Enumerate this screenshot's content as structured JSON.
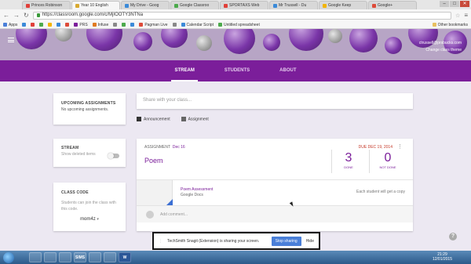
{
  "browser": {
    "tabs": [
      {
        "label": "Princes Robinson",
        "color": "#e0403a",
        "active": false
      },
      {
        "label": "Year 10 English",
        "color": "#d8a930",
        "active": true
      },
      {
        "label": "My Drive - Goog",
        "color": "#3b8ad8",
        "active": false
      },
      {
        "label": "Google Classroo",
        "color": "#4caa4c",
        "active": false
      },
      {
        "label": "SPORTAXS Web",
        "color": "#e0403a",
        "active": false
      },
      {
        "label": "Mr Trussell - Du",
        "color": "#3b8ad8",
        "active": false
      },
      {
        "label": "Google Keep",
        "color": "#f2b400",
        "active": false
      },
      {
        "label": "Google+",
        "color": "#dd4b39",
        "active": false
      }
    ],
    "window_controls": {
      "min": "–",
      "max": "□",
      "close": "✕"
    },
    "url": "https://classroom.google.com/c/MjIOOTY3NTNa",
    "bookmarks": [
      {
        "label": "Apps"
      },
      {
        "label": ""
      },
      {
        "label": ""
      },
      {
        "label": ""
      },
      {
        "label": ""
      },
      {
        "label": ""
      },
      {
        "label": ""
      },
      {
        "label": "PRS"
      },
      {
        "label": "Infuse"
      },
      {
        "label": ""
      },
      {
        "label": ""
      },
      {
        "label": ""
      },
      {
        "label": "Pagman Live"
      },
      {
        "label": ""
      },
      {
        "label": "Calendar Script"
      },
      {
        "label": "Untitled spreadsheet"
      },
      {
        "label": "Other bookmarks"
      }
    ]
  },
  "header": {
    "user_email": "ctrussell@prsbucks.com",
    "change_theme": "Change class theme"
  },
  "nav": {
    "tabs": [
      {
        "label": "STREAM",
        "active": true
      },
      {
        "label": "STUDENTS",
        "active": false
      },
      {
        "label": "ABOUT",
        "active": false
      }
    ]
  },
  "sidebar": {
    "upcoming_title": "UPCOMING ASSIGNMENTS",
    "upcoming_text": "No upcoming assignments.",
    "stream_title": "STREAM",
    "show_deleted": "Show deleted items",
    "class_code_title": "CLASS CODE",
    "class_code_text": "Students can join the class with this code.",
    "class_code_value": "mom4z"
  },
  "share": {
    "placeholder": "Share with your class...",
    "announcement": "Announcement",
    "assignment": "Assignment"
  },
  "assignment": {
    "label": "ASSIGNMENT",
    "date": "Dec 16",
    "due": "DUE DEC 19, 2014",
    "title": "Poem",
    "done_count": "3",
    "done_label": "DONE",
    "not_done_count": "0",
    "not_done_label": "NOT DONE",
    "attachment_title": "Poem Assessment",
    "attachment_source": "Google Docs",
    "copy_note": "Each student will get a copy",
    "comment_placeholder": "Add comment..."
  },
  "toast": {
    "message": "TechSmith Snagit (Extension) is sharing your screen.",
    "stop": "Stop sharing",
    "hide": "Hide"
  },
  "help": "?",
  "taskbar": {
    "items": [
      "",
      "",
      "",
      "SIMS",
      "",
      "",
      "W"
    ],
    "time": "21:29",
    "date": "12/01/2015"
  },
  "colors": {
    "accent": "#7b1e9a",
    "due": "#c53929",
    "button": "#4a7fd8"
  }
}
